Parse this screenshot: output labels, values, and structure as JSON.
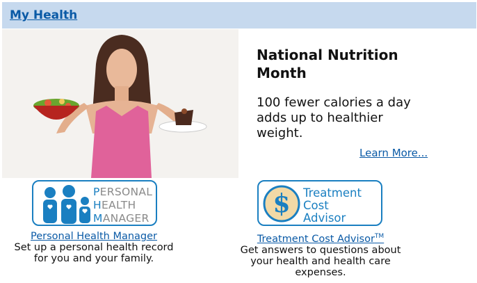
{
  "header": {
    "title": "My Health"
  },
  "promo": {
    "title": "National Nutrition Month",
    "text": "100 fewer calories a day adds up to healthier weight.",
    "link": "Learn More..."
  },
  "tiles": [
    {
      "logo_lines": [
        {
          "cap": "P",
          "rest": "ERSONAL"
        },
        {
          "cap": "H",
          "rest": "EALTH"
        },
        {
          "cap": "M",
          "rest": "ANAGER"
        }
      ],
      "link": "Personal Health Manager",
      "description": "Set up a personal health record for you and your family."
    },
    {
      "logo_lines": [
        "Treatment",
        "Cost",
        "Advisor"
      ],
      "link": "Treatment Cost Advisor",
      "link_sup": "TM",
      "description": "Get answers to questions about your health and health care expenses."
    }
  ],
  "colors": {
    "header_bg": "#c6d9ee",
    "link": "#0a5aa6",
    "logo_blue": "#1a7fc1"
  }
}
